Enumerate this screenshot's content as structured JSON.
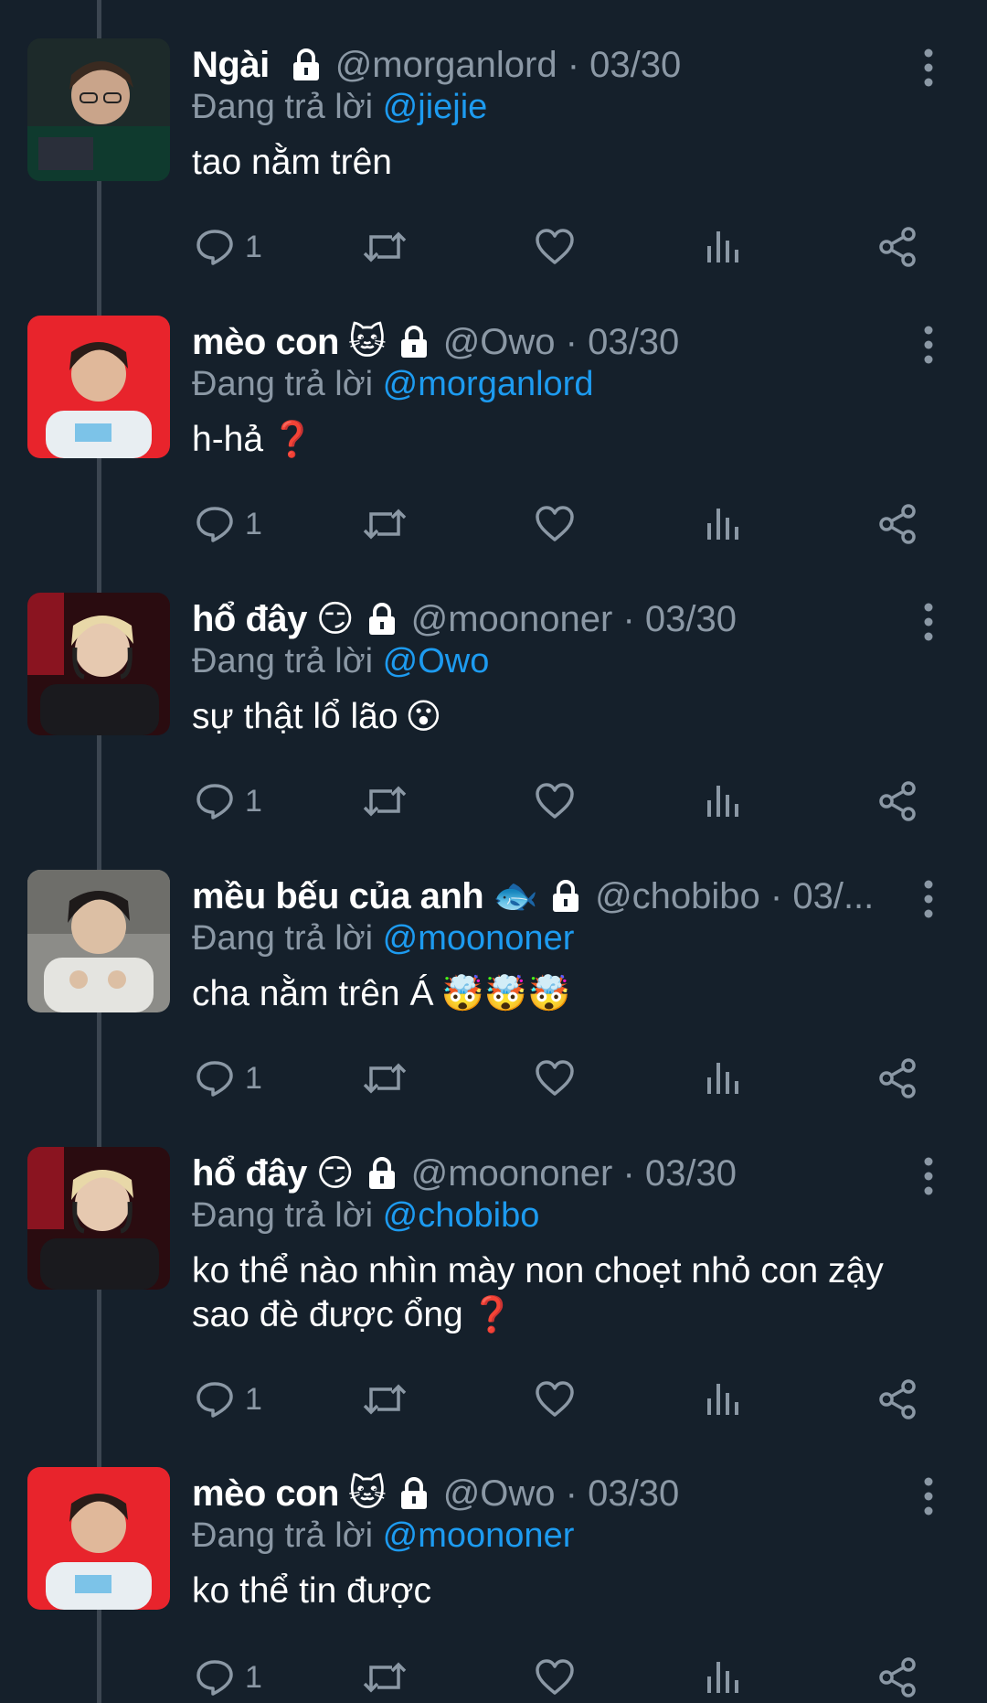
{
  "colors": {
    "background": "#15202b",
    "secondary_text": "#8b98a5",
    "mention": "#1d9bf0",
    "thread_line": "#3c4651"
  },
  "icons": [
    "lock-icon",
    "more-icon",
    "reply-icon",
    "retweet-icon",
    "like-icon",
    "views-icon",
    "share-icon"
  ],
  "tweets": [
    {
      "name": "Ngài",
      "emoji": "",
      "handle": "@morganlord · 03/30",
      "replying_label": "Đang trả lời",
      "replying_to": "@jiejie",
      "text": "tao nằm trên",
      "text_emoji": "",
      "text_line2": "",
      "text_line2_emoji": "",
      "reply_count": "1"
    },
    {
      "name": "mèo con",
      "emoji": "🐱",
      "handle": "@Owo · 03/30",
      "replying_label": "Đang trả lời",
      "replying_to": "@morganlord",
      "text": "h-hả",
      "text_emoji": "❓",
      "text_line2": "",
      "text_line2_emoji": "",
      "reply_count": "1"
    },
    {
      "name": "hổ đây",
      "emoji": "😏",
      "handle": "@moononer · 03/30",
      "replying_label": "Đang trả lời",
      "replying_to": "@Owo",
      "text": "sự thật lổ lão",
      "text_emoji": "😮",
      "text_line2": "",
      "text_line2_emoji": "",
      "reply_count": "1"
    },
    {
      "name": "mều bếu của anh",
      "emoji": "🐟",
      "handle": "@chobibo · 03/...",
      "replying_label": "Đang trả lời",
      "replying_to": "@moononer",
      "text": "cha nằm trên Á",
      "text_emoji": "🤯🤯🤯",
      "text_line2": "",
      "text_line2_emoji": "",
      "reply_count": "1"
    },
    {
      "name": "hổ đây",
      "emoji": "😏",
      "handle": "@moononer · 03/30",
      "replying_label": "Đang trả lời",
      "replying_to": "@chobibo",
      "text": "ko thể nào nhìn mày non choẹt nhỏ con zậy",
      "text_emoji": "",
      "text_line2": "sao đè được ổng",
      "text_line2_emoji": "❓",
      "reply_count": "1"
    },
    {
      "name": "mèo con",
      "emoji": "🐱",
      "handle": "@Owo · 03/30",
      "replying_label": "Đang trả lời",
      "replying_to": "@moononer",
      "text": "ko thể tin được",
      "text_emoji": "",
      "text_line2": "",
      "text_line2_emoji": "",
      "reply_count": "1"
    }
  ]
}
